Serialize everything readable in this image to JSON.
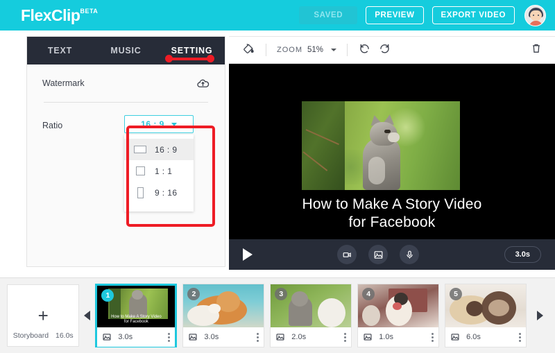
{
  "header": {
    "logo_text": "FlexClip",
    "logo_badge": "BETA",
    "saved_label": "SAVED",
    "preview_label": "PREVIEW",
    "export_label": "EXPORT VIDEO",
    "brand_color": "#15ccdd",
    "avatar_name": "user-avatar"
  },
  "left_panel": {
    "tabs": [
      {
        "label": "TEXT",
        "active": false
      },
      {
        "label": "MUSIC",
        "active": false
      },
      {
        "label": "SETTING",
        "active": true
      }
    ],
    "watermark": {
      "label": "Watermark",
      "icon": "cloud-upload-icon"
    },
    "ratio": {
      "label": "Ratio",
      "selected": "16 : 9",
      "options": [
        {
          "label": "16 : 9",
          "shape": "wide",
          "highlighted": true
        },
        {
          "label": "1 : 1",
          "shape": "square",
          "highlighted": false
        },
        {
          "label": "9 : 16",
          "shape": "tall",
          "highlighted": false
        }
      ]
    },
    "annotation_color": "#ee1c25"
  },
  "toolbar": {
    "fill_icon": "paint-bucket-icon",
    "zoom_label": "ZOOM",
    "zoom_value": "51%",
    "undo_icon": "undo-icon",
    "redo_icon": "redo-icon",
    "delete_icon": "trash-icon"
  },
  "canvas": {
    "title_line1": "How to Make A Story Video",
    "title_line2": "for Facebook",
    "background_color": "#000000"
  },
  "player": {
    "play_icon": "play-icon",
    "video_icon": "video-camera-icon",
    "image_icon": "image-icon",
    "mic_icon": "microphone-icon",
    "duration": "3.0s"
  },
  "storyboard": {
    "add_label": "Storyboard",
    "total_duration": "16.0s",
    "prev_icon": "chevron-left-icon",
    "next_icon": "chevron-right-icon",
    "clips": [
      {
        "number": "1",
        "duration": "3.0s",
        "selected": true,
        "title_line1": "How to Make A Story Video",
        "title_line2": "for Facebook"
      },
      {
        "number": "2",
        "duration": "3.0s",
        "selected": false,
        "title_line1": "",
        "title_line2": ""
      },
      {
        "number": "3",
        "duration": "2.0s",
        "selected": false,
        "title_line1": "",
        "title_line2": ""
      },
      {
        "number": "4",
        "duration": "1.0s",
        "selected": false,
        "title_line1": "",
        "title_line2": ""
      },
      {
        "number": "5",
        "duration": "6.0s",
        "selected": false,
        "title_line1": "",
        "title_line2": ""
      }
    ]
  }
}
